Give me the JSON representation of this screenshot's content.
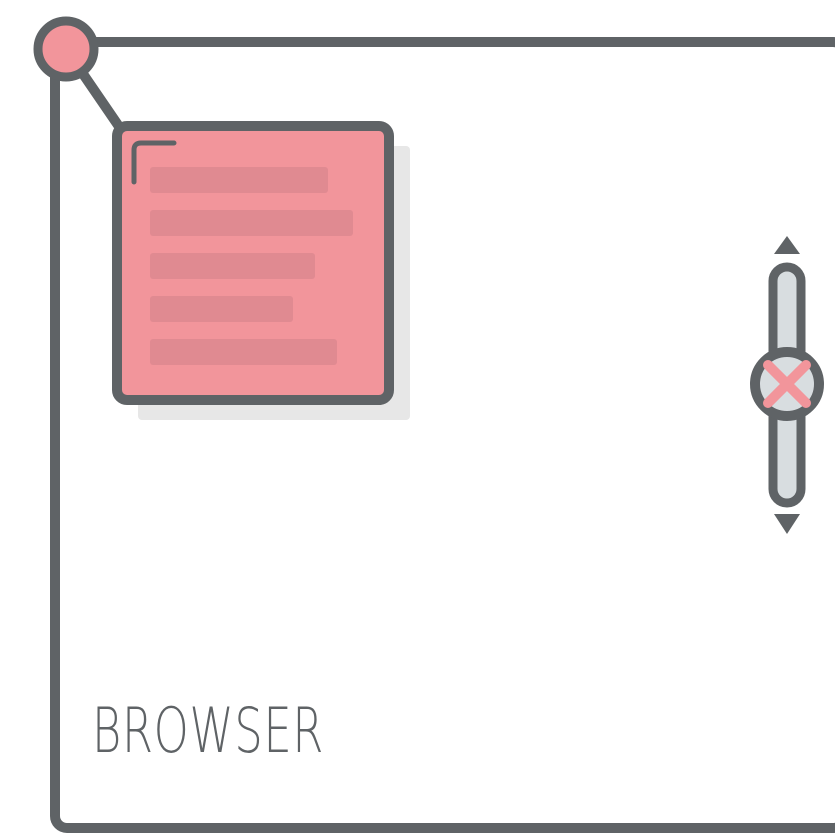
{
  "browser": {
    "label": "BROWSER"
  },
  "colors": {
    "stroke": "#5f6366",
    "accent_pink": "#f2959b",
    "text_line": "#e08a91",
    "shadow": "#e7e7e7",
    "scroll_track": "#d8dde0"
  },
  "icons": {
    "corner_knob": "circle-icon",
    "scroll_up": "triangle-up-icon",
    "scroll_down": "triangle-down-icon",
    "scroll_handle": "close-icon",
    "card_corner": "corner-bracket-icon"
  },
  "popup_card": {
    "text_line_count": 5
  }
}
